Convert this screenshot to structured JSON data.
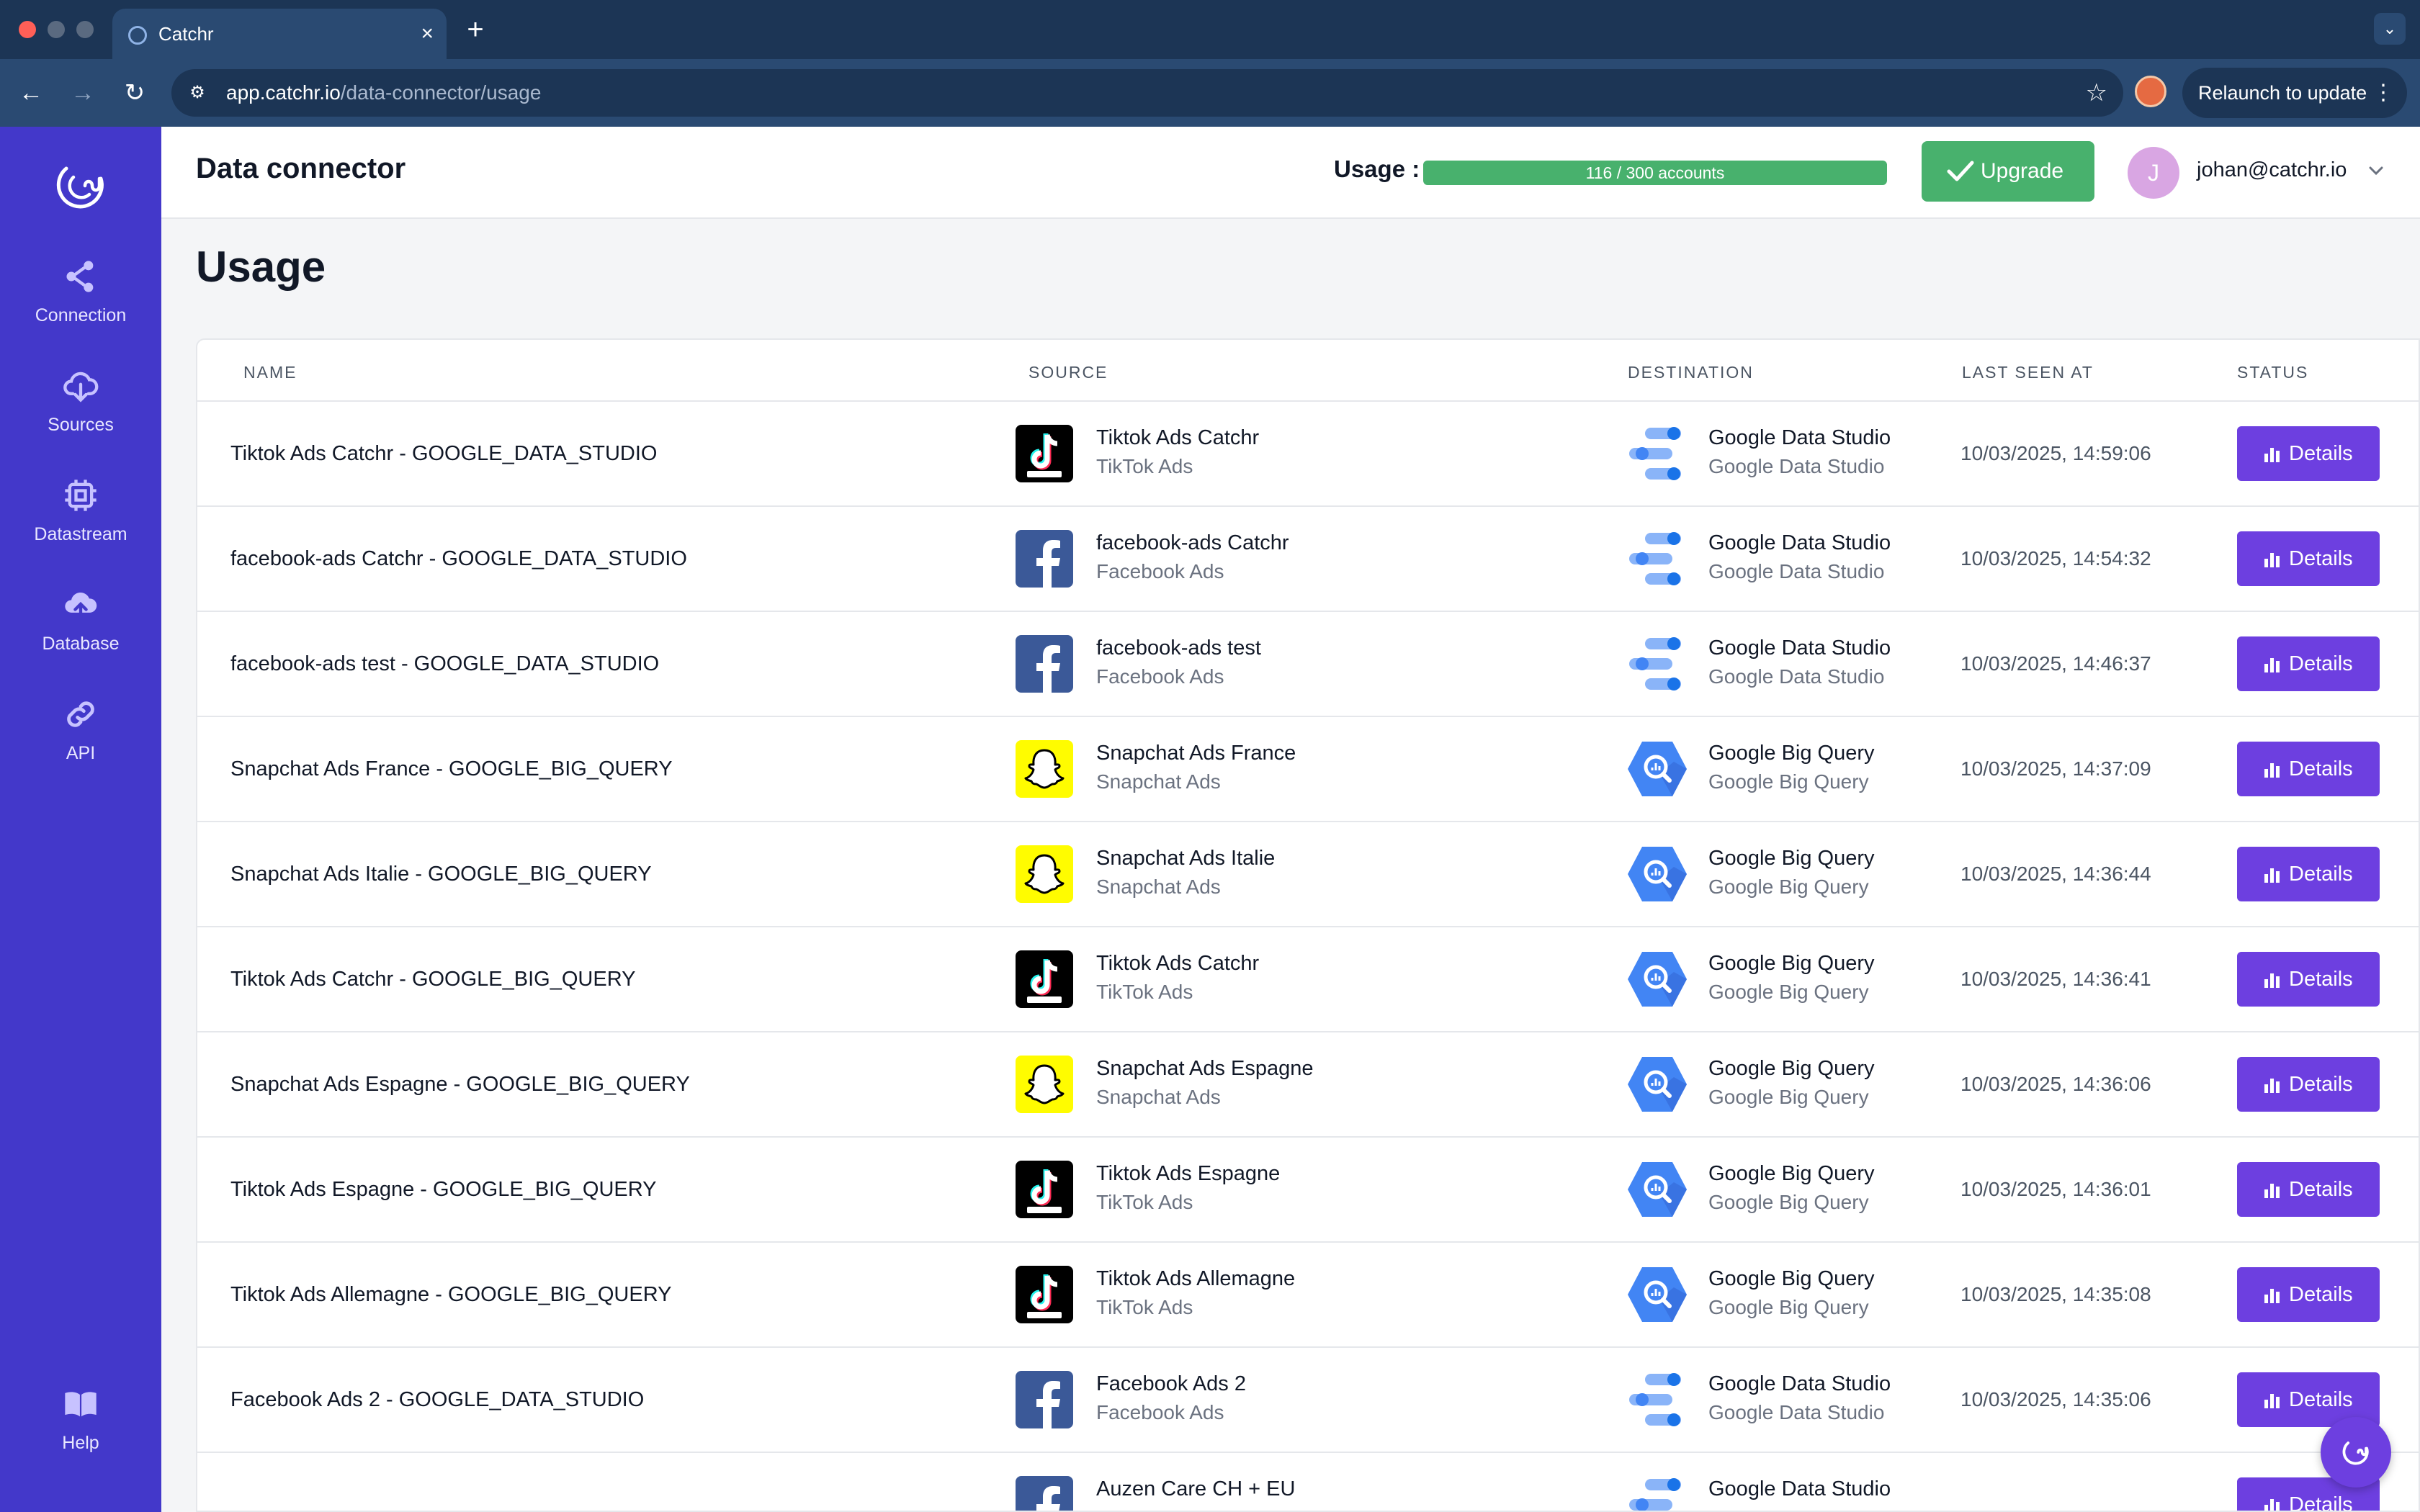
{
  "browser": {
    "tab_title": "Catchr",
    "tab_close": "×",
    "new_tab": "+",
    "tab_menu": "⌄",
    "url_host": "app.catchr.io",
    "url_path": "/data-connector/usage",
    "relaunch_label": "Relaunch to update",
    "relaunch_dots": "⋮",
    "back": "←",
    "forward": "→",
    "reload": "↻",
    "star": "☆",
    "site_info": "⚙"
  },
  "sidebar": {
    "items": [
      {
        "label": "Connection",
        "icon": "share-icon"
      },
      {
        "label": "Sources",
        "icon": "cloud-download-icon"
      },
      {
        "label": "Datastream",
        "icon": "chip-icon"
      },
      {
        "label": "Database",
        "icon": "cloud-upload-icon"
      },
      {
        "label": "API",
        "icon": "link-icon"
      },
      {
        "label": "Help",
        "icon": "book-icon"
      }
    ]
  },
  "header": {
    "title": "Data connector",
    "usage_label": "Usage :",
    "usage_text": "116 / 300 accounts",
    "usage_fraction": 1.0,
    "upgrade_label": "Upgrade",
    "avatar_initial": "J",
    "user_email": "johan@catchr.io"
  },
  "main": {
    "title": "Usage",
    "columns": [
      "NAME",
      "SOURCE",
      "DESTINATION",
      "LAST SEEN AT",
      "STATUS"
    ],
    "details_label": "Details",
    "rows": [
      {
        "name": "Tiktok Ads Catchr - GOOGLE_DATA_STUDIO",
        "source_title": "Tiktok Ads Catchr",
        "source_sub": "TikTok Ads",
        "source_icon": "tiktok-icon",
        "dest_title": "Google Data Studio",
        "dest_sub": "Google Data Studio",
        "dest_icon": "google-data-studio-icon",
        "last_seen": "10/03/2025, 14:59:06"
      },
      {
        "name": "facebook-ads Catchr - GOOGLE_DATA_STUDIO",
        "source_title": "facebook-ads Catchr",
        "source_sub": "Facebook Ads",
        "source_icon": "facebook-icon",
        "dest_title": "Google Data Studio",
        "dest_sub": "Google Data Studio",
        "dest_icon": "google-data-studio-icon",
        "last_seen": "10/03/2025, 14:54:32"
      },
      {
        "name": "facebook-ads test - GOOGLE_DATA_STUDIO",
        "source_title": "facebook-ads test",
        "source_sub": "Facebook Ads",
        "source_icon": "facebook-icon",
        "dest_title": "Google Data Studio",
        "dest_sub": "Google Data Studio",
        "dest_icon": "google-data-studio-icon",
        "last_seen": "10/03/2025, 14:46:37"
      },
      {
        "name": "Snapchat Ads France - GOOGLE_BIG_QUERY",
        "source_title": "Snapchat Ads France",
        "source_sub": "Snapchat Ads",
        "source_icon": "snapchat-icon",
        "dest_title": "Google Big Query",
        "dest_sub": "Google Big Query",
        "dest_icon": "google-big-query-icon",
        "last_seen": "10/03/2025, 14:37:09"
      },
      {
        "name": "Snapchat Ads Italie - GOOGLE_BIG_QUERY",
        "source_title": "Snapchat Ads Italie",
        "source_sub": "Snapchat Ads",
        "source_icon": "snapchat-icon",
        "dest_title": "Google Big Query",
        "dest_sub": "Google Big Query",
        "dest_icon": "google-big-query-icon",
        "last_seen": "10/03/2025, 14:36:44"
      },
      {
        "name": "Tiktok Ads Catchr - GOOGLE_BIG_QUERY",
        "source_title": "Tiktok Ads Catchr",
        "source_sub": "TikTok Ads",
        "source_icon": "tiktok-icon",
        "dest_title": "Google Big Query",
        "dest_sub": "Google Big Query",
        "dest_icon": "google-big-query-icon",
        "last_seen": "10/03/2025, 14:36:41"
      },
      {
        "name": "Snapchat Ads Espagne - GOOGLE_BIG_QUERY",
        "source_title": "Snapchat Ads Espagne",
        "source_sub": "Snapchat Ads",
        "source_icon": "snapchat-icon",
        "dest_title": "Google Big Query",
        "dest_sub": "Google Big Query",
        "dest_icon": "google-big-query-icon",
        "last_seen": "10/03/2025, 14:36:06"
      },
      {
        "name": "Tiktok Ads Espagne - GOOGLE_BIG_QUERY",
        "source_title": "Tiktok Ads Espagne",
        "source_sub": "TikTok Ads",
        "source_icon": "tiktok-icon",
        "dest_title": "Google Big Query",
        "dest_sub": "Google Big Query",
        "dest_icon": "google-big-query-icon",
        "last_seen": "10/03/2025, 14:36:01"
      },
      {
        "name": "Tiktok Ads Allemagne - GOOGLE_BIG_QUERY",
        "source_title": "Tiktok Ads Allemagne",
        "source_sub": "TikTok Ads",
        "source_icon": "tiktok-icon",
        "dest_title": "Google Big Query",
        "dest_sub": "Google Big Query",
        "dest_icon": "google-big-query-icon",
        "last_seen": "10/03/2025, 14:35:08"
      },
      {
        "name": "Facebook Ads 2 - GOOGLE_DATA_STUDIO",
        "source_title": "Facebook Ads 2",
        "source_sub": "Facebook Ads",
        "source_icon": "facebook-icon",
        "dest_title": "Google Data Studio",
        "dest_sub": "Google Data Studio",
        "dest_icon": "google-data-studio-icon",
        "last_seen": "10/03/2025, 14:35:06"
      },
      {
        "name": "",
        "source_title": "Auzen Care CH + EU",
        "source_sub": "",
        "source_icon": "facebook-icon",
        "dest_title": "Google Data Studio",
        "dest_sub": "",
        "dest_icon": "google-data-studio-icon",
        "last_seen": ""
      }
    ]
  },
  "colors": {
    "sidebar": "#4338ca",
    "accent": "#6d3fe0",
    "success": "#48b16d",
    "browser_dark": "#1c3555",
    "browser_light": "#2a4a72"
  }
}
